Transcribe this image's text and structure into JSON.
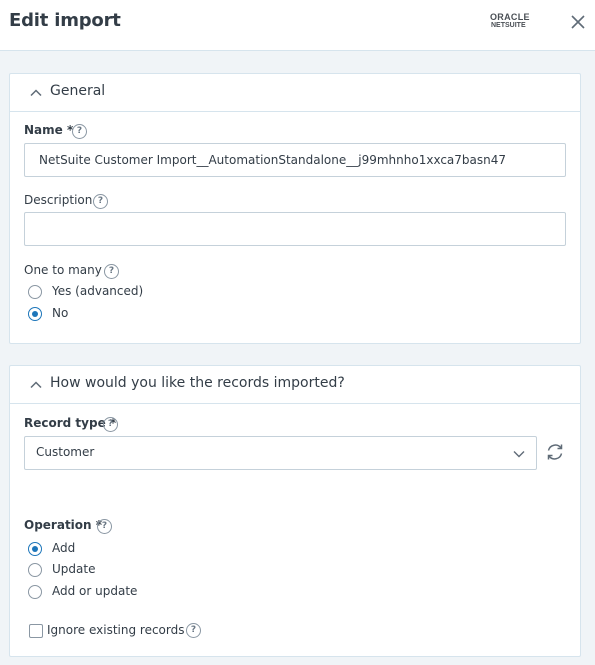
{
  "header": {
    "title": "Edit import",
    "logo_line1": "ORACLE",
    "logo_line2": "NETSUITE"
  },
  "general": {
    "title": "General",
    "name_label": "Name *",
    "name_value": "NetSuite Customer Import__AutomationStandalone__j99mhnho1xxca7basn47",
    "description_label": "Description",
    "description_value": "",
    "one_to_many_label": "One to many",
    "one_to_many_options": [
      {
        "label": "Yes (advanced)",
        "checked": false
      },
      {
        "label": "No",
        "checked": true
      }
    ]
  },
  "records": {
    "title": "How would you like the records imported?",
    "record_type_label": "Record type *",
    "record_type_value": "Customer",
    "operation_label": "Operation *",
    "operation_options": [
      {
        "label": "Add",
        "checked": true
      },
      {
        "label": "Update",
        "checked": false
      },
      {
        "label": "Add or update",
        "checked": false
      }
    ],
    "ignore_existing_label": "Ignore existing records",
    "ignore_existing_checked": false
  },
  "help_glyph": "?",
  "colors": {
    "accent": "#1d76ba",
    "border": "#d6e4ed",
    "background": "#f0f4f7",
    "text": "#333d47"
  },
  "icons": [
    "close-icon",
    "chevron-up-icon",
    "chevron-down-icon",
    "refresh-icon",
    "help-icon"
  ]
}
